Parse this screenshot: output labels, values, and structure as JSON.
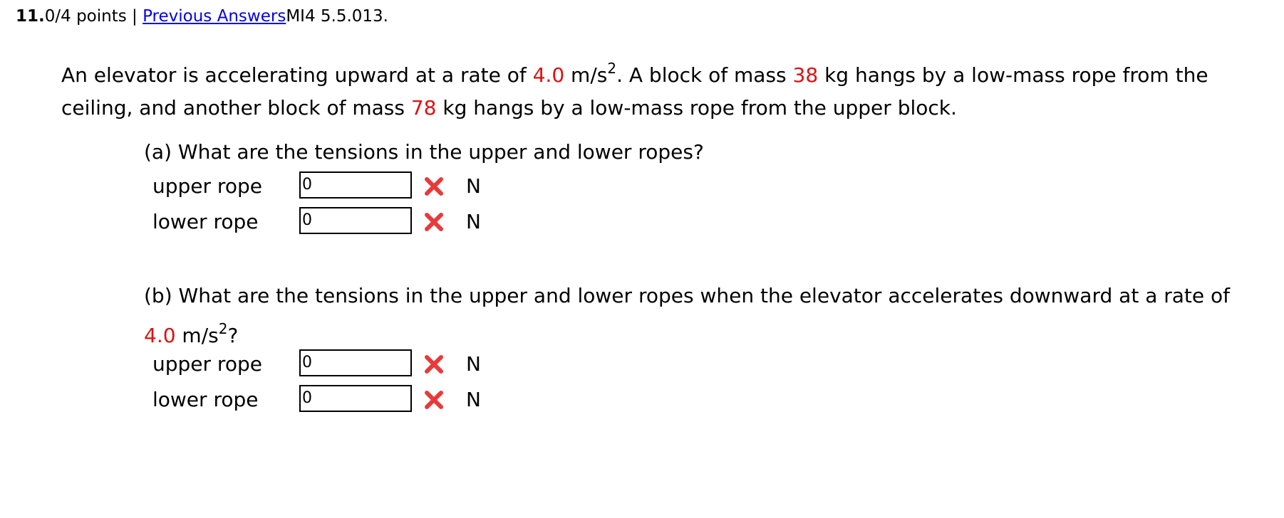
{
  "header": {
    "number": "11.",
    "points": "0/4 points |",
    "link": "Previous Answers",
    "code": "MI4 5.5.013."
  },
  "problem": {
    "t1": "An elevator is accelerating upward at a rate of ",
    "accel": "4.0",
    "t2": " m/s",
    "exp": "2",
    "t3": ". A block of mass ",
    "mass1": "38",
    "t4": " kg hangs by a low-mass rope from the ceiling, and another block of mass ",
    "mass2": "78",
    "t5": " kg hangs by a low-mass rope from the upper block."
  },
  "part_a": {
    "question": "(a) What are the tensions in the upper and lower ropes?",
    "rows": [
      {
        "label": "upper rope",
        "value": "0",
        "unit": "N",
        "status": "incorrect"
      },
      {
        "label": "lower rope",
        "value": "0",
        "unit": "N",
        "status": "incorrect"
      }
    ]
  },
  "part_b": {
    "q1": "(b) What are the tensions in the upper and lower ropes when the elevator accelerates downward at a rate of ",
    "accel": "4.0",
    "q2": " m/s",
    "exp": "2",
    "q3": "?",
    "rows": [
      {
        "label": "upper rope",
        "value": "0",
        "unit": "N",
        "status": "incorrect"
      },
      {
        "label": "lower rope",
        "value": "0",
        "unit": "N",
        "status": "incorrect"
      }
    ]
  },
  "colors": {
    "highlight": "#e01010",
    "link": "#0000ee",
    "incorrect_mark": "#e83a3a"
  },
  "icons": {
    "incorrect": "x-mark-icon"
  }
}
